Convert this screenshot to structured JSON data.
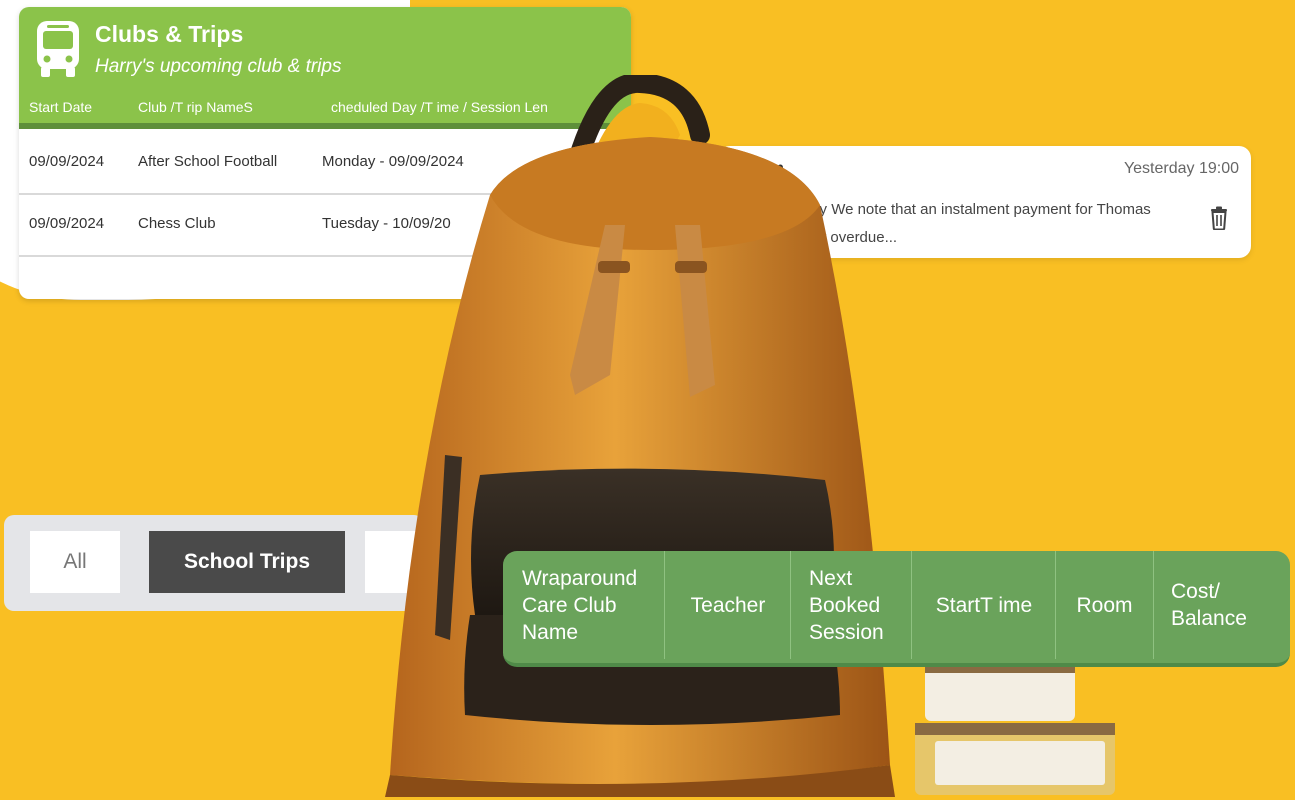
{
  "clubs": {
    "title": "Clubs & Trips",
    "subtitle": "Harry's upcoming club & trips",
    "columns": [
      "Start Date",
      "Club /T rip NameS",
      "cheduled Day /T ime / Session Len"
    ],
    "rows": [
      [
        "09/09/2024",
        "After School Football",
        "Monday - 09/09/2024"
      ],
      [
        "09/09/2024",
        "Chess Club",
        "Tuesday - 10/09/20"
      ]
    ]
  },
  "message": {
    "from": "System",
    "time": "Yesterday 19:00",
    "body": "Dear Mr Kutlay We note that an instalment payment for Thomas Aspinall is now overdue..."
  },
  "tabs": [
    "All",
    "School Trips"
  ],
  "wraparound": {
    "columns": [
      [
        "Wraparound",
        "Care Club",
        "Name"
      ],
      [
        "Teacher"
      ],
      [
        "Next",
        "Booked",
        "Session"
      ],
      [
        "StartT ime"
      ],
      [
        "Room"
      ],
      [
        "Cost/",
        "Balance"
      ]
    ]
  },
  "colors": {
    "background": "#f9bf23",
    "clubs_header": "#8bc34a",
    "wraparound_header": "#6aa35b",
    "active_tab": "#4a4a4a"
  },
  "icons": [
    "bus-icon",
    "trash-icon"
  ]
}
